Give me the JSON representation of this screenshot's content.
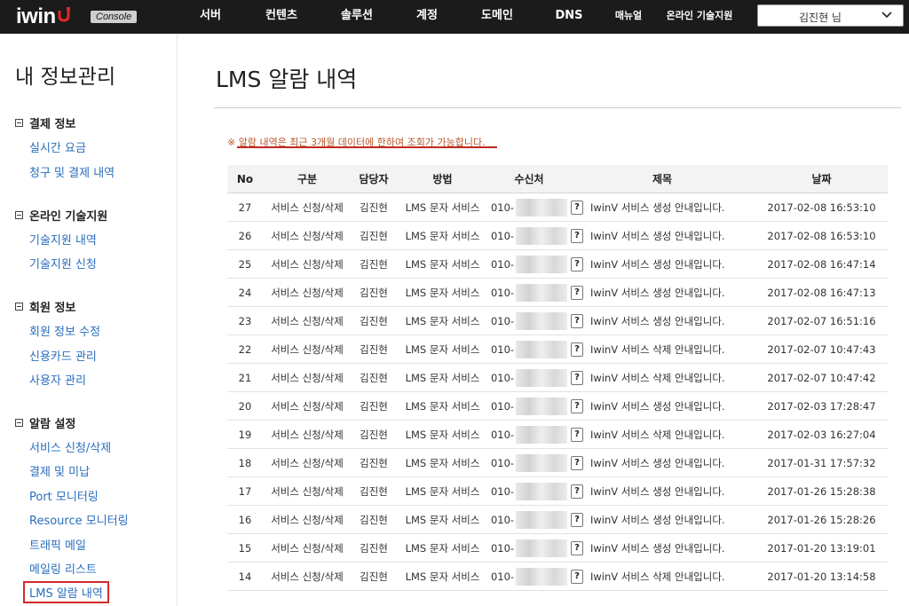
{
  "header": {
    "logo_text": "iwin",
    "console_label": "Console",
    "nav": [
      "서버",
      "컨텐츠",
      "솔루션",
      "계정",
      "도메인",
      "DNS",
      "매뉴얼",
      "온라인 기술지원"
    ],
    "user_name": "김진현 님"
  },
  "sidebar": {
    "title": "내 정보관리",
    "sections": [
      {
        "label": "결제 정보",
        "items": [
          "실시간 요금",
          "청구 및 결제 내역"
        ]
      },
      {
        "label": "온라인 기술지원",
        "items": [
          "기술지원 내역",
          "기술지원 신청"
        ]
      },
      {
        "label": "회원 정보",
        "items": [
          "회원 정보 수정",
          "신용카드 관리",
          "사용자 관리"
        ]
      },
      {
        "label": "알람 설정",
        "items": [
          "서비스 신청/삭제",
          "결제 및 미납",
          "Port 모니터링",
          "Resource 모니터링",
          "트래픽 메일",
          "메일링 리스트",
          "LMS 알람 내역"
        ]
      }
    ],
    "active_item": "LMS 알람 내역"
  },
  "main": {
    "title": "LMS 알람 내역",
    "notice": "※ 알람 내역은 최근 3개월 데이터에 한하여 조회가 가능합니다.",
    "table": {
      "headers": [
        "No",
        "구분",
        "담당자",
        "방법",
        "수신처",
        "제목",
        "날짜"
      ],
      "rows": [
        {
          "no": "27",
          "type": "서비스 신청/삭제",
          "manager": "김진현",
          "method": "LMS 문자 서비스",
          "phone": "010-",
          "subject": "IwinV 서비스 생성 안내입니다.",
          "date": "2017-02-08 16:53:10"
        },
        {
          "no": "26",
          "type": "서비스 신청/삭제",
          "manager": "김진현",
          "method": "LMS 문자 서비스",
          "phone": "010-",
          "subject": "IwinV 서비스 생성 안내입니다.",
          "date": "2017-02-08 16:53:10"
        },
        {
          "no": "25",
          "type": "서비스 신청/삭제",
          "manager": "김진현",
          "method": "LMS 문자 서비스",
          "phone": "010-",
          "subject": "IwinV 서비스 생성 안내입니다.",
          "date": "2017-02-08 16:47:14"
        },
        {
          "no": "24",
          "type": "서비스 신청/삭제",
          "manager": "김진현",
          "method": "LMS 문자 서비스",
          "phone": "010-",
          "subject": "IwinV 서비스 생성 안내입니다.",
          "date": "2017-02-08 16:47:13"
        },
        {
          "no": "23",
          "type": "서비스 신청/삭제",
          "manager": "김진현",
          "method": "LMS 문자 서비스",
          "phone": "010-",
          "subject": "IwinV 서비스 생성 안내입니다.",
          "date": "2017-02-07 16:51:16"
        },
        {
          "no": "22",
          "type": "서비스 신청/삭제",
          "manager": "김진현",
          "method": "LMS 문자 서비스",
          "phone": "010-",
          "subject": "IwinV 서비스 삭제 안내입니다.",
          "date": "2017-02-07 10:47:43"
        },
        {
          "no": "21",
          "type": "서비스 신청/삭제",
          "manager": "김진현",
          "method": "LMS 문자 서비스",
          "phone": "010-",
          "subject": "IwinV 서비스 삭제 안내입니다.",
          "date": "2017-02-07 10:47:42"
        },
        {
          "no": "20",
          "type": "서비스 신청/삭제",
          "manager": "김진현",
          "method": "LMS 문자 서비스",
          "phone": "010-",
          "subject": "IwinV 서비스 생성 안내입니다.",
          "date": "2017-02-03 17:28:47"
        },
        {
          "no": "19",
          "type": "서비스 신청/삭제",
          "manager": "김진현",
          "method": "LMS 문자 서비스",
          "phone": "010-",
          "subject": "IwinV 서비스 삭제 안내입니다.",
          "date": "2017-02-03 16:27:04"
        },
        {
          "no": "18",
          "type": "서비스 신청/삭제",
          "manager": "김진현",
          "method": "LMS 문자 서비스",
          "phone": "010-",
          "subject": "IwinV 서비스 생성 안내입니다.",
          "date": "2017-01-31 17:57:32"
        },
        {
          "no": "17",
          "type": "서비스 신청/삭제",
          "manager": "김진현",
          "method": "LMS 문자 서비스",
          "phone": "010-",
          "subject": "IwinV 서비스 생성 안내입니다.",
          "date": "2017-01-26 15:28:38"
        },
        {
          "no": "16",
          "type": "서비스 신청/삭제",
          "manager": "김진현",
          "method": "LMS 문자 서비스",
          "phone": "010-",
          "subject": "IwinV 서비스 생성 안내입니다.",
          "date": "2017-01-26 15:28:26"
        },
        {
          "no": "15",
          "type": "서비스 신청/삭제",
          "manager": "김진현",
          "method": "LMS 문자 서비스",
          "phone": "010-",
          "subject": "IwinV 서비스 생성 안내입니다.",
          "date": "2017-01-20 13:19:01"
        },
        {
          "no": "14",
          "type": "서비스 신청/삭제",
          "manager": "김진현",
          "method": "LMS 문자 서비스",
          "phone": "010-",
          "subject": "IwinV 서비스 삭제 안내입니다.",
          "date": "2017-01-20 13:14:58"
        }
      ]
    }
  },
  "colors": {
    "topbar": "#1b1b1b",
    "link": "#2a6ebd",
    "notice": "#b7572a",
    "highlight_border": "#d42a2a",
    "logo_accent": "#e0252a"
  }
}
